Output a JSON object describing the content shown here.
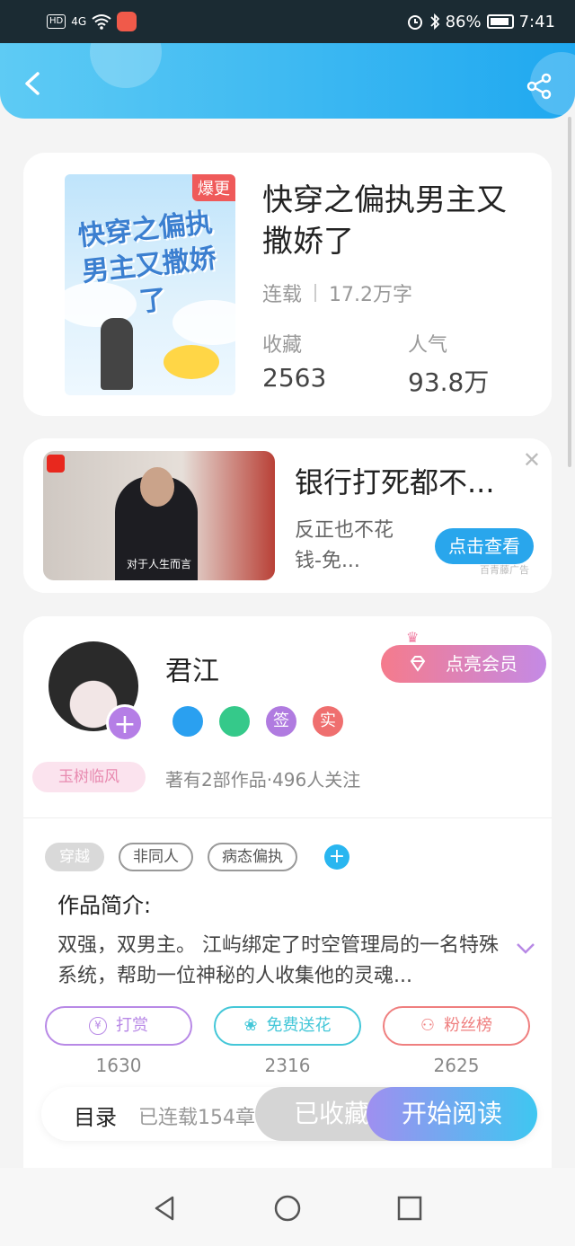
{
  "status_bar": {
    "hd_label": "HD",
    "signal_label": "4G",
    "battery_pct": "86%",
    "time": "7:41"
  },
  "header": {
    "back_icon": "chevron-left-icon",
    "share_icon": "share-icon"
  },
  "book": {
    "cover_badge": "爆更",
    "cover_art_text": "快穿之偏执男主又撒娇了",
    "title": "快穿之偏执男主又撒娇了",
    "status": "连载",
    "word_count": "17.2万字",
    "collect_label": "收藏",
    "collect_value": "2563",
    "popularity_label": "人气",
    "popularity_value": "93.8万"
  },
  "ad": {
    "caption": "对于人生而言",
    "title": "银行打死都不...",
    "description": "反正也不花钱-免...",
    "cta": "点击查看",
    "source": "百青藤广告",
    "close_icon": "close-icon"
  },
  "author": {
    "name": "君江",
    "vip_button": "点亮会员",
    "follow_plus": "+",
    "badges": [
      {
        "icon": "music-badge-icon",
        "text": "",
        "color": "#2aa0f0"
      },
      {
        "icon": "handshake-badge-icon",
        "text": "",
        "color": "#35c98a"
      },
      {
        "icon": "sign-badge-icon",
        "text": "签",
        "color": "#b07be0"
      },
      {
        "icon": "real-badge-icon",
        "text": "实",
        "color": "#ef6f6f"
      }
    ],
    "fans_tag": "玉树临风",
    "stats": "著有2部作品·496人关注"
  },
  "work": {
    "tags": [
      "穿越",
      "非同人",
      "病态偏执"
    ],
    "tag_add": "+",
    "intro_label": "作品简介:",
    "intro_text": "双强，双男主。 江屿绑定了时空管理局的一名特殊系统，帮助一位神秘的人收集他的灵魂...",
    "actions": [
      {
        "label": "打赏",
        "icon": "yen-coin-icon",
        "count": "1630"
      },
      {
        "label": "免费送花",
        "icon": "flower-icon",
        "count": "2316"
      },
      {
        "label": "粉丝榜",
        "icon": "user-icon",
        "count": "2625"
      }
    ]
  },
  "reader_bar": {
    "toc": "目录",
    "serial": "已连载154章",
    "collected": "已收藏",
    "start_reading": "开始阅读"
  },
  "nav": {
    "back_icon": "triangle-back-icon",
    "home_icon": "circle-home-icon",
    "recent_icon": "square-recents-icon"
  },
  "colors": {
    "header_accent": "#1fa8f0",
    "read_gradient_start": "#9f8ff0",
    "read_gradient_end": "#3ec7f1"
  }
}
